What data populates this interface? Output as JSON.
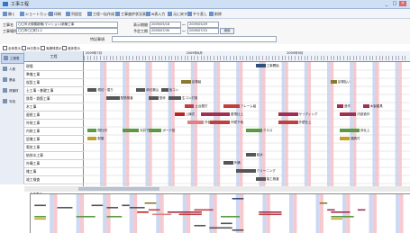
{
  "window": {
    "title": "工事工程",
    "minimize": "_",
    "maximize": "□",
    "close": "×"
  },
  "toolbar": {
    "items": [
      {
        "label": "開く",
        "icon": "folder-icon"
      },
      {
        "label": "ショートカット",
        "icon": "shortcut-icon"
      },
      {
        "label": "印刷",
        "icon": "print-icon"
      },
      {
        "label": "列設定",
        "icon": "columns-icon"
      },
      {
        "label": "工程一括作成",
        "icon": "calendar-icon"
      },
      {
        "label": "工事進捗状況表",
        "icon": "progress-icon"
      },
      {
        "label": "w表入力",
        "icon": "input-icon"
      },
      {
        "label": "元に戻す",
        "icon": "undo-icon"
      },
      {
        "label": "やり直し",
        "icon": "redo-icon"
      },
      {
        "label": "削除",
        "icon": "delete-icon"
      }
    ]
  },
  "filter": {
    "project_label": "工事名",
    "project_value": "〇〇市大規模新築(マンション)新築工事",
    "period_label": "表示期間",
    "period_from": "2009/05/16",
    "period_to": "2009/05/29",
    "place_label": "工事場所",
    "place_value": "〇〇市〇〇町1-2",
    "plan_label": "予定工期",
    "plan_from": "2009/07/30",
    "plan_to": "2009/07/31",
    "apply": "適用",
    "note_label": "特記事項",
    "checks": [
      "全体表示",
      "休日表示",
      "実績残表示",
      "進捗表示"
    ]
  },
  "sidebar": {
    "items": [
      {
        "label": "工程表",
        "icon": "gantt-icon"
      },
      {
        "label": "人員",
        "icon": "people-icon"
      },
      {
        "label": "業者",
        "icon": "vendor-icon"
      },
      {
        "label": "資機材",
        "icon": "material-icon"
      },
      {
        "label": "写真",
        "icon": "photo-icon"
      }
    ]
  },
  "gantt": {
    "name_header": "工程",
    "months": [
      "2009年7月",
      "2009年8月",
      "2009年9月"
    ],
    "rows": [
      "現場",
      "準備工事",
      "仮設工事",
      "土工事・基礎工事",
      "鉄骨・鉄筋工事",
      "木工事",
      "屋根工事",
      "外装工事",
      "内装工事",
      "設備工事",
      "電気工事",
      "給排水工事",
      "外構工事",
      "雑工事",
      "竣工検査"
    ],
    "bars": [
      {
        "row": 0,
        "start": 53,
        "end": 56,
        "color": "#2f4f7a",
        "label": "工事開始"
      },
      {
        "row": 2,
        "start": 30,
        "end": 33,
        "color": "#8a7a30",
        "label": "足場組"
      },
      {
        "row": 2,
        "start": 76,
        "end": 78,
        "color": "#8a7a30",
        "label": "足場払い"
      },
      {
        "row": 3,
        "start": 1,
        "end": 4,
        "color": "#555",
        "label": "根切・掘り"
      },
      {
        "row": 3,
        "start": 16,
        "end": 19,
        "color": "#555",
        "label": "砕石敷込"
      },
      {
        "row": 3,
        "start": 24,
        "end": 26,
        "color": "#555",
        "label": "捨コン"
      },
      {
        "row": 4,
        "start": 7,
        "end": 11,
        "color": "#555",
        "label": "配筋検査"
      },
      {
        "row": 4,
        "start": 20,
        "end": 23,
        "color": "#555",
        "label": "型枠"
      },
      {
        "row": 4,
        "start": 26,
        "end": 30,
        "color": "#555",
        "label": "生コン打設"
      },
      {
        "row": 5,
        "start": 31,
        "end": 34,
        "color": "#c04040",
        "label": "土台据付"
      },
      {
        "row": 5,
        "start": 43,
        "end": 48,
        "color": "#c04040",
        "label": "フレーム組"
      },
      {
        "row": 5,
        "start": 78,
        "end": 80,
        "color": "#a03050",
        "label": "造作"
      },
      {
        "row": 5,
        "start": 86,
        "end": 88,
        "color": "#a03050",
        "label": "木製建具"
      },
      {
        "row": 6,
        "start": 28,
        "end": 31,
        "color": "#c02020",
        "label": "上棟式"
      },
      {
        "row": 6,
        "start": 36,
        "end": 45,
        "color": "#a03050",
        "label": "屋根仕上"
      },
      {
        "row": 6,
        "start": 60,
        "end": 66,
        "color": "#a03050",
        "label": "サイディング"
      },
      {
        "row": 6,
        "start": 79,
        "end": 84,
        "color": "#a03050",
        "label": "内部造作"
      },
      {
        "row": 7,
        "start": 32,
        "end": 37,
        "color": "#e08080",
        "label": "外部防水"
      },
      {
        "row": 7,
        "start": 39,
        "end": 45,
        "color": "#c04040",
        "label": "外壁下地"
      },
      {
        "row": 7,
        "start": 60,
        "end": 66,
        "color": "#c04040",
        "label": "外壁仕上"
      },
      {
        "row": 8,
        "start": 1,
        "end": 4,
        "color": "#5a9a40",
        "label": "間仕切"
      },
      {
        "row": 8,
        "start": 12,
        "end": 17,
        "color": "#5a9a40",
        "label": "天井下地"
      },
      {
        "row": 8,
        "start": 20,
        "end": 24,
        "color": "#5a9a40",
        "label": "ボード貼"
      },
      {
        "row": 8,
        "start": 50,
        "end": 55,
        "color": "#5a9a40",
        "label": "クロス"
      },
      {
        "row": 8,
        "start": 79,
        "end": 85,
        "color": "#5a9a40",
        "label": "床仕上"
      },
      {
        "row": 9,
        "start": 1,
        "end": 4,
        "color": "#c0a020",
        "label": "配管"
      },
      {
        "row": 9,
        "start": 79,
        "end": 82,
        "color": "#c0a020",
        "label": "器具付"
      },
      {
        "row": 11,
        "start": 50,
        "end": 53,
        "color": "#555",
        "label": "給水"
      },
      {
        "row": 12,
        "start": 43,
        "end": 46,
        "color": "#555",
        "label": "外構"
      },
      {
        "row": 13,
        "start": 47,
        "end": 53,
        "color": "#555",
        "label": "クリーニング"
      },
      {
        "row": 14,
        "start": 53,
        "end": 56,
        "color": "#555",
        "label": "竣工検査"
      }
    ]
  },
  "overview": {
    "label": "全体表示"
  }
}
